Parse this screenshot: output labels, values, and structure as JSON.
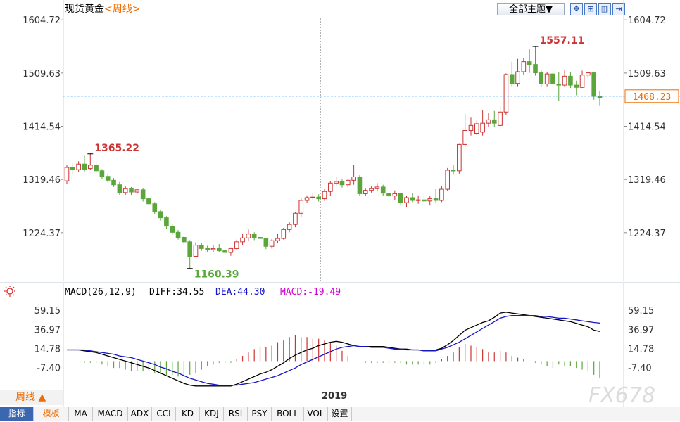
{
  "header": {
    "title": "现货黄金",
    "period_tag": "<周线>",
    "theme_button": "全部主题▼",
    "tool_icons": [
      "crosshair-icon",
      "bar-zoom-icon",
      "chart-type-icon",
      "fullscreen-icon"
    ]
  },
  "chart_data": [
    {
      "type": "candlestick",
      "title": "现货黄金",
      "period": "周线",
      "ylim": [
        1150,
        1610
      ],
      "y_ticks": [
        1604.72,
        1509.63,
        1414.54,
        1319.46,
        1224.37
      ],
      "y_tick_labels": [
        "1604.72",
        "1509.63",
        "1414.54",
        "1319.46",
        "1224.37"
      ],
      "x_tick_labels": [
        "2019"
      ],
      "current_price": 1468.23,
      "current_price_label": "1468.23",
      "annotations": [
        {
          "label": "1365.22",
          "value": 1365.22,
          "type": "high"
        },
        {
          "label": "1160.39",
          "value": 1160.39,
          "type": "low"
        },
        {
          "label": "1557.11",
          "value": 1557.11,
          "type": "high"
        }
      ],
      "candles": [
        [
          1317,
          1345,
          1341,
          1312
        ],
        [
          1341,
          1348,
          1337,
          1330
        ],
        [
          1337,
          1352,
          1347,
          1333
        ],
        [
          1347,
          1362,
          1337,
          1332
        ],
        [
          1339,
          1366,
          1345,
          1337
        ],
        [
          1345,
          1352,
          1335,
          1330
        ],
        [
          1335,
          1338,
          1325,
          1320
        ],
        [
          1325,
          1330,
          1318,
          1314
        ],
        [
          1318,
          1322,
          1310,
          1306
        ],
        [
          1310,
          1315,
          1296,
          1292
        ],
        [
          1296,
          1307,
          1303,
          1292
        ],
        [
          1303,
          1306,
          1297,
          1292
        ],
        [
          1297,
          1302,
          1301,
          1294
        ],
        [
          1301,
          1304,
          1285,
          1280
        ],
        [
          1285,
          1289,
          1276,
          1272
        ],
        [
          1276,
          1279,
          1262,
          1258
        ],
        [
          1262,
          1265,
          1251,
          1246
        ],
        [
          1251,
          1254,
          1236,
          1231
        ],
        [
          1236,
          1239,
          1225,
          1221
        ],
        [
          1225,
          1229,
          1216,
          1212
        ],
        [
          1216,
          1219,
          1208,
          1203
        ],
        [
          1208,
          1211,
          1182,
          1160
        ],
        [
          1182,
          1207,
          1202,
          1180
        ],
        [
          1202,
          1206,
          1196,
          1192
        ],
        [
          1196,
          1201,
          1194,
          1190
        ],
        [
          1194,
          1202,
          1196,
          1190
        ],
        [
          1196,
          1204,
          1192,
          1189
        ],
        [
          1192,
          1196,
          1189,
          1186
        ],
        [
          1189,
          1198,
          1196,
          1183
        ],
        [
          1196,
          1212,
          1208,
          1193
        ],
        [
          1208,
          1222,
          1215,
          1202
        ],
        [
          1215,
          1230,
          1222,
          1210
        ],
        [
          1222,
          1225,
          1216,
          1211
        ],
        [
          1216,
          1222,
          1214,
          1209
        ],
        [
          1214,
          1214,
          1200,
          1195
        ],
        [
          1200,
          1213,
          1210,
          1196
        ],
        [
          1210,
          1223,
          1214,
          1206
        ],
        [
          1214,
          1233,
          1230,
          1212
        ],
        [
          1230,
          1244,
          1239,
          1225
        ],
        [
          1239,
          1262,
          1259,
          1234
        ],
        [
          1259,
          1287,
          1282,
          1252
        ],
        [
          1282,
          1291,
          1287,
          1278
        ],
        [
          1287,
          1296,
          1288,
          1283
        ],
        [
          1288,
          1293,
          1285,
          1280
        ],
        [
          1285,
          1302,
          1298,
          1281
        ],
        [
          1298,
          1316,
          1313,
          1290
        ],
        [
          1313,
          1324,
          1316,
          1308
        ],
        [
          1316,
          1321,
          1310,
          1305
        ],
        [
          1310,
          1321,
          1318,
          1306
        ],
        [
          1318,
          1345,
          1324,
          1310
        ],
        [
          1324,
          1327,
          1294,
          1290
        ],
        [
          1294,
          1303,
          1300,
          1290
        ],
        [
          1300,
          1307,
          1303,
          1296
        ],
        [
          1303,
          1313,
          1306,
          1298
        ],
        [
          1306,
          1310,
          1295,
          1290
        ],
        [
          1295,
          1298,
          1290,
          1286
        ],
        [
          1290,
          1300,
          1294,
          1282
        ],
        [
          1294,
          1296,
          1278,
          1274
        ],
        [
          1278,
          1290,
          1287,
          1270
        ],
        [
          1287,
          1295,
          1282,
          1279
        ],
        [
          1282,
          1291,
          1283,
          1276
        ],
        [
          1283,
          1296,
          1281,
          1276
        ],
        [
          1281,
          1290,
          1285,
          1273
        ],
        [
          1285,
          1302,
          1282,
          1278
        ],
        [
          1282,
          1308,
          1302,
          1279
        ],
        [
          1302,
          1340,
          1336,
          1299
        ],
        [
          1336,
          1345,
          1335,
          1328
        ],
        [
          1335,
          1383,
          1382,
          1330
        ],
        [
          1382,
          1437,
          1407,
          1378
        ],
        [
          1407,
          1430,
          1416,
          1398
        ],
        [
          1402,
          1425,
          1419,
          1399
        ],
        [
          1404,
          1443,
          1420,
          1398
        ],
        [
          1420,
          1438,
          1426,
          1413
        ],
        [
          1426,
          1442,
          1420,
          1413
        ],
        [
          1416,
          1451,
          1440,
          1410
        ],
        [
          1440,
          1509,
          1507,
          1435
        ],
        [
          1507,
          1530,
          1491,
          1486
        ],
        [
          1491,
          1535,
          1512,
          1486
        ],
        [
          1512,
          1537,
          1530,
          1507
        ],
        [
          1530,
          1552,
          1525,
          1510
        ],
        [
          1525,
          1557,
          1510,
          1505
        ],
        [
          1510,
          1515,
          1490,
          1485
        ],
        [
          1490,
          1512,
          1508,
          1486
        ],
        [
          1508,
          1516,
          1490,
          1486
        ],
        [
          1490,
          1512,
          1488,
          1460
        ],
        [
          1488,
          1515,
          1504,
          1485
        ],
        [
          1504,
          1512,
          1488,
          1483
        ],
        [
          1488,
          1496,
          1484,
          1470
        ],
        [
          1484,
          1514,
          1506,
          1483
        ],
        [
          1506,
          1512,
          1510,
          1500
        ],
        [
          1510,
          1512,
          1468,
          1462
        ],
        [
          1468,
          1478,
          1465,
          1452
        ]
      ]
    },
    {
      "type": "line",
      "title": "MACD(26,12,9)",
      "ylim": [
        -30,
        70
      ],
      "y_ticks": [
        59.15,
        36.97,
        14.78,
        -7.4
      ],
      "y_tick_labels": [
        "59.15",
        "36.97",
        "14.78",
        "-7.40"
      ],
      "legend": [
        {
          "label": "MACD(26,12,9)",
          "color": "#000000"
        },
        {
          "label": "DIFF:34.55",
          "color": "#000000"
        },
        {
          "label": "DEA:44.30",
          "color": "#1515c8"
        },
        {
          "label": "MACD:-19.49",
          "color": "#d000d0"
        }
      ],
      "series": [
        {
          "name": "DIFF",
          "color": "#000000",
          "values": [
            13,
            13,
            13,
            12,
            11,
            10,
            8,
            6,
            4,
            2,
            0,
            -2,
            -4,
            -6,
            -8,
            -11,
            -14,
            -17,
            -20,
            -23,
            -26,
            -28,
            -29,
            -29,
            -29,
            -29,
            -29,
            -29,
            -29,
            -27,
            -24,
            -21,
            -18,
            -15,
            -13,
            -10,
            -6,
            -2,
            3,
            7,
            10,
            13,
            15,
            18,
            20,
            22,
            23,
            22,
            20,
            18,
            17,
            17,
            17,
            17,
            17,
            16,
            15,
            14,
            14,
            13,
            13,
            12,
            12,
            13,
            15,
            19,
            24,
            30,
            36,
            39,
            42,
            45,
            47,
            51,
            56,
            57,
            56,
            55,
            54,
            53,
            52,
            51,
            50,
            49,
            48,
            47,
            46,
            44,
            42,
            40,
            36,
            34.55
          ]
        },
        {
          "name": "DEA",
          "color": "#1515c8",
          "values": [
            13,
            13,
            13,
            13,
            12,
            11,
            10,
            9,
            8,
            6,
            5,
            4,
            2,
            0,
            -2,
            -4,
            -7,
            -9,
            -12,
            -14,
            -17,
            -20,
            -22,
            -24,
            -26,
            -27,
            -28,
            -28,
            -28,
            -28,
            -27,
            -26,
            -25,
            -23,
            -21,
            -19,
            -17,
            -14,
            -11,
            -8,
            -4,
            -1,
            2,
            5,
            8,
            11,
            14,
            16,
            17,
            18,
            17,
            17,
            16,
            16,
            16,
            15,
            14,
            14,
            13,
            13,
            13,
            12,
            12,
            12,
            14,
            16,
            19,
            22,
            26,
            30,
            34,
            38,
            42,
            46,
            50,
            52,
            53,
            53,
            53,
            53,
            53,
            52,
            52,
            51,
            50,
            50,
            49,
            48,
            47,
            46,
            45,
            44.3
          ]
        },
        {
          "name": "MACD",
          "color": "#d000d0",
          "bars": true,
          "values": [
            0,
            0,
            0,
            -2,
            -2,
            -2,
            -4,
            -6,
            -8,
            -8,
            -10,
            -12,
            -12,
            -12,
            -12,
            -14,
            -14,
            -16,
            -16,
            -18,
            -18,
            -16,
            -14,
            -10,
            -6,
            -4,
            -2,
            -2,
            -2,
            2,
            6,
            10,
            14,
            16,
            16,
            18,
            22,
            24,
            28,
            30,
            28,
            28,
            26,
            26,
            24,
            22,
            18,
            12,
            6,
            0,
            0,
            -2,
            -2,
            -2,
            -2,
            -2,
            -2,
            -2,
            -4,
            -4,
            -4,
            -4,
            -4,
            -2,
            2,
            6,
            10,
            16,
            20,
            18,
            16,
            14,
            10,
            10,
            12,
            10,
            6,
            4,
            2,
            0,
            -2,
            -4,
            -6,
            -8,
            -4,
            -6,
            -6,
            -8,
            -10,
            -12,
            -16,
            -19.49
          ]
        }
      ]
    }
  ],
  "macd_legend": {
    "name": "MACD(26,12,9)",
    "diff": "DIFF:34.55",
    "dea": "DEA:44.30",
    "macd": "MACD:-19.49"
  },
  "x_label_year": "2019",
  "period_button": "周线 ▲",
  "tabs": [
    "指标",
    "模板",
    "MA",
    "MACD",
    "ADX",
    "CCI",
    "KD",
    "KDJ",
    "RSI",
    "PSY",
    "BOLL",
    "VOL",
    "设置"
  ],
  "watermark": "FX678",
  "colors": {
    "up": "#cc3333",
    "down": "#5aa63a",
    "price_line": "#1e90ff",
    "axis_text": "#333333",
    "accent": "#ef6c00"
  }
}
